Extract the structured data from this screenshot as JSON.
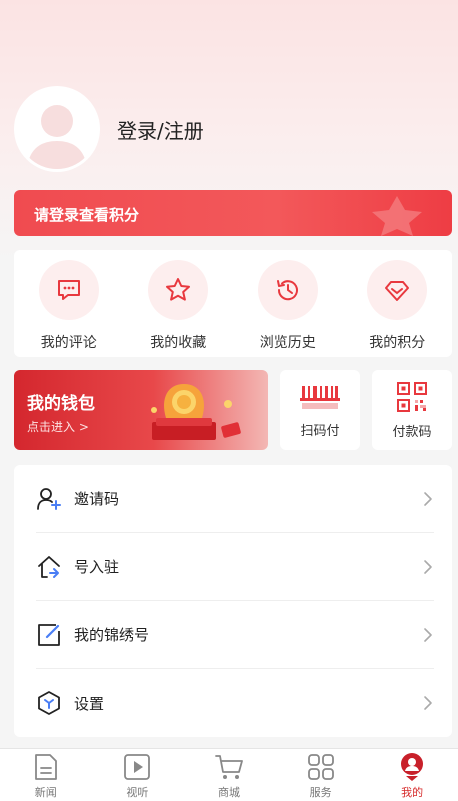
{
  "profile": {
    "login_label": "登录/注册"
  },
  "points_banner": {
    "label": "请登录查看积分"
  },
  "quick_actions": [
    {
      "label": "我的评论",
      "icon": "comment-icon"
    },
    {
      "label": "我的收藏",
      "icon": "star-icon"
    },
    {
      "label": "浏览历史",
      "icon": "history-icon"
    },
    {
      "label": "我的积分",
      "icon": "diamond-icon"
    }
  ],
  "wallet": {
    "title": "我的钱包",
    "subtitle": "点击进入 >"
  },
  "pay": {
    "scan_label": "扫码付",
    "code_label": "付款码"
  },
  "menu": [
    {
      "label": "邀请码",
      "icon": "add-user-icon"
    },
    {
      "label": "号入驻",
      "icon": "home-enter-icon"
    },
    {
      "label": "我的锦绣号",
      "icon": "edit-icon"
    },
    {
      "label": "设置",
      "icon": "settings-icon"
    }
  ],
  "tabs": [
    {
      "label": "新闻",
      "icon": "news-icon"
    },
    {
      "label": "视听",
      "icon": "video-icon"
    },
    {
      "label": "商城",
      "icon": "cart-icon"
    },
    {
      "label": "服务",
      "icon": "grid-icon"
    },
    {
      "label": "我的",
      "icon": "mine-icon",
      "active": true
    }
  ],
  "colors": {
    "accent": "#e8383e",
    "bg": "#f5f5f5",
    "active_tab": "#d62b2b"
  }
}
